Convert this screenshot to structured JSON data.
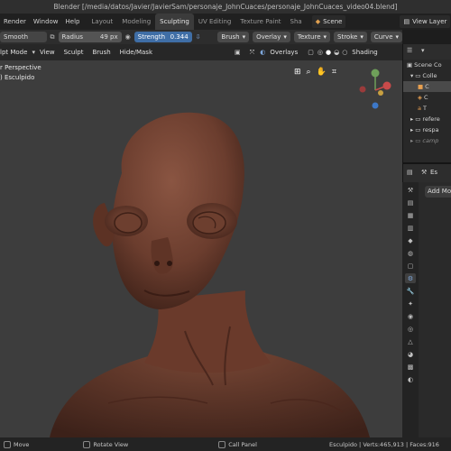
{
  "window": {
    "title": "Blender [/media/datos/Javier/JavierSam/personaje_JohnCuaces/personaje_JohnCuaces_video04.blend]"
  },
  "menubar": {
    "menus": [
      "Render",
      "Window",
      "Help"
    ],
    "workspaces": [
      "Layout",
      "Modeling",
      "Sculpting",
      "UV Editing",
      "Texture Paint",
      "Sha"
    ],
    "active_workspace": "Sculpting",
    "scene": "Scene",
    "view_layer": "View Layer"
  },
  "tool_header": {
    "brush_name": "Smooth",
    "radius_label": "Radius",
    "radius_value": "49 px",
    "strength_label": "Strength",
    "strength_value": "0.344",
    "dropdowns": [
      "Brush",
      "Overlay",
      "Texture",
      "Stroke",
      "Curve"
    ]
  },
  "viewport_header": {
    "mode": "lpt Mode",
    "menus": [
      "View",
      "Sculpt",
      "Brush",
      "Hide/Mask"
    ],
    "overlays": "Overlays",
    "shading": "Shading"
  },
  "viewport": {
    "view_name": "r Perspective",
    "object_name": ") Esculpido",
    "gizmo_axes": {
      "x": "X",
      "y": "Y",
      "z": "Z"
    }
  },
  "outliner": {
    "rows": [
      {
        "label": "Scene Co",
        "indent": 0
      },
      {
        "label": "Colle",
        "indent": 1
      },
      {
        "label": "C",
        "indent": 2
      },
      {
        "label": "C",
        "indent": 2
      },
      {
        "label": "T",
        "indent": 2
      },
      {
        "label": "refere",
        "indent": 1
      },
      {
        "label": "respa",
        "indent": 1
      },
      {
        "label": "camp",
        "indent": 1
      }
    ]
  },
  "properties": {
    "header_label": "Es",
    "add_modifier": "Add Modi"
  },
  "statusbar": {
    "left": "Move",
    "middle": "Rotate View",
    "right_action": "Call Panel",
    "stats": "Esculpido | Verts:465,913 | Faces:916"
  },
  "colors": {
    "accent_blue": "#3f6ea6",
    "active_tab": "#3b3b3b",
    "viewport_bg": "#3d3d3d",
    "skin": "#6b3d2e"
  }
}
